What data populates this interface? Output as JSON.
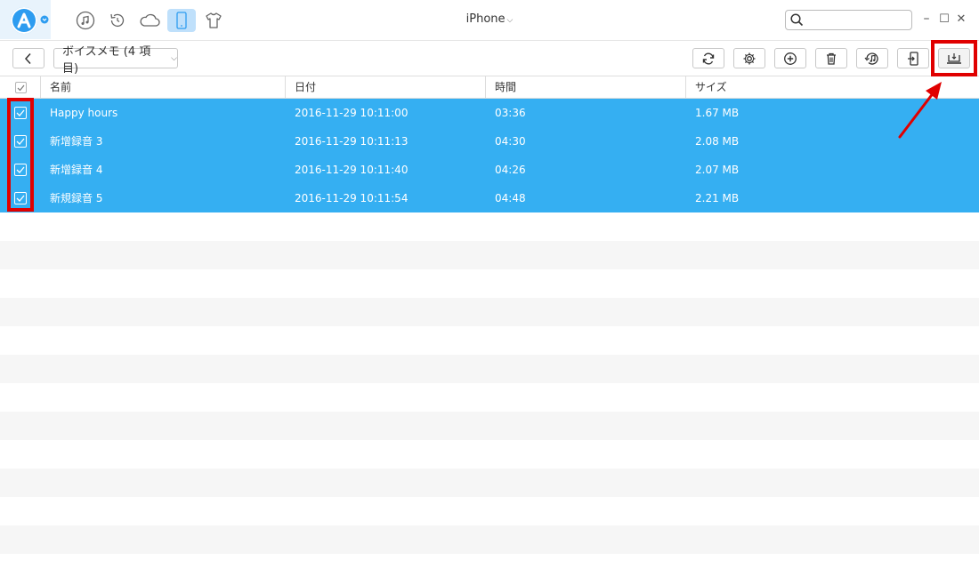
{
  "title_bar": {
    "device_name": "iPhone",
    "device_caret": "⌵",
    "search_placeholder": "",
    "nav_icons": [
      "music-icon",
      "restore-icon",
      "cloud-icon",
      "phone-icon",
      "tshirt-icon"
    ],
    "window_controls": {
      "minimize": "–",
      "maximize": "☐",
      "close": "✕"
    }
  },
  "toolbar": {
    "back_glyph": "‹",
    "category_label": "ボイスメモ (4 項目)",
    "category_caret": "⌵",
    "buttons": [
      "refresh-icon",
      "settings-icon",
      "add-icon",
      "delete-icon",
      "itunes-icon",
      "to-device-icon",
      "to-computer-icon"
    ]
  },
  "table": {
    "columns": [
      "名前",
      "日付",
      "時間",
      "サイズ"
    ],
    "rows": [
      {
        "name": "Happy hours",
        "date": "2016-11-29 10:11:00",
        "time": "03:36",
        "size": "1.67 MB",
        "checked": true
      },
      {
        "name": "新增録音 3",
        "date": "2016-11-29 10:11:13",
        "time": "04:30",
        "size": "2.08 MB",
        "checked": true
      },
      {
        "name": "新增録音 4",
        "date": "2016-11-29 10:11:40",
        "time": "04:26",
        "size": "2.07 MB",
        "checked": true
      },
      {
        "name": "新規録音 5",
        "date": "2016-11-29 10:11:54",
        "time": "04:48",
        "size": "2.21 MB",
        "checked": true
      }
    ]
  },
  "colors": {
    "selected_row": "#35aff2",
    "highlight_box": "#e00000",
    "accent": "#2d9cf0"
  }
}
